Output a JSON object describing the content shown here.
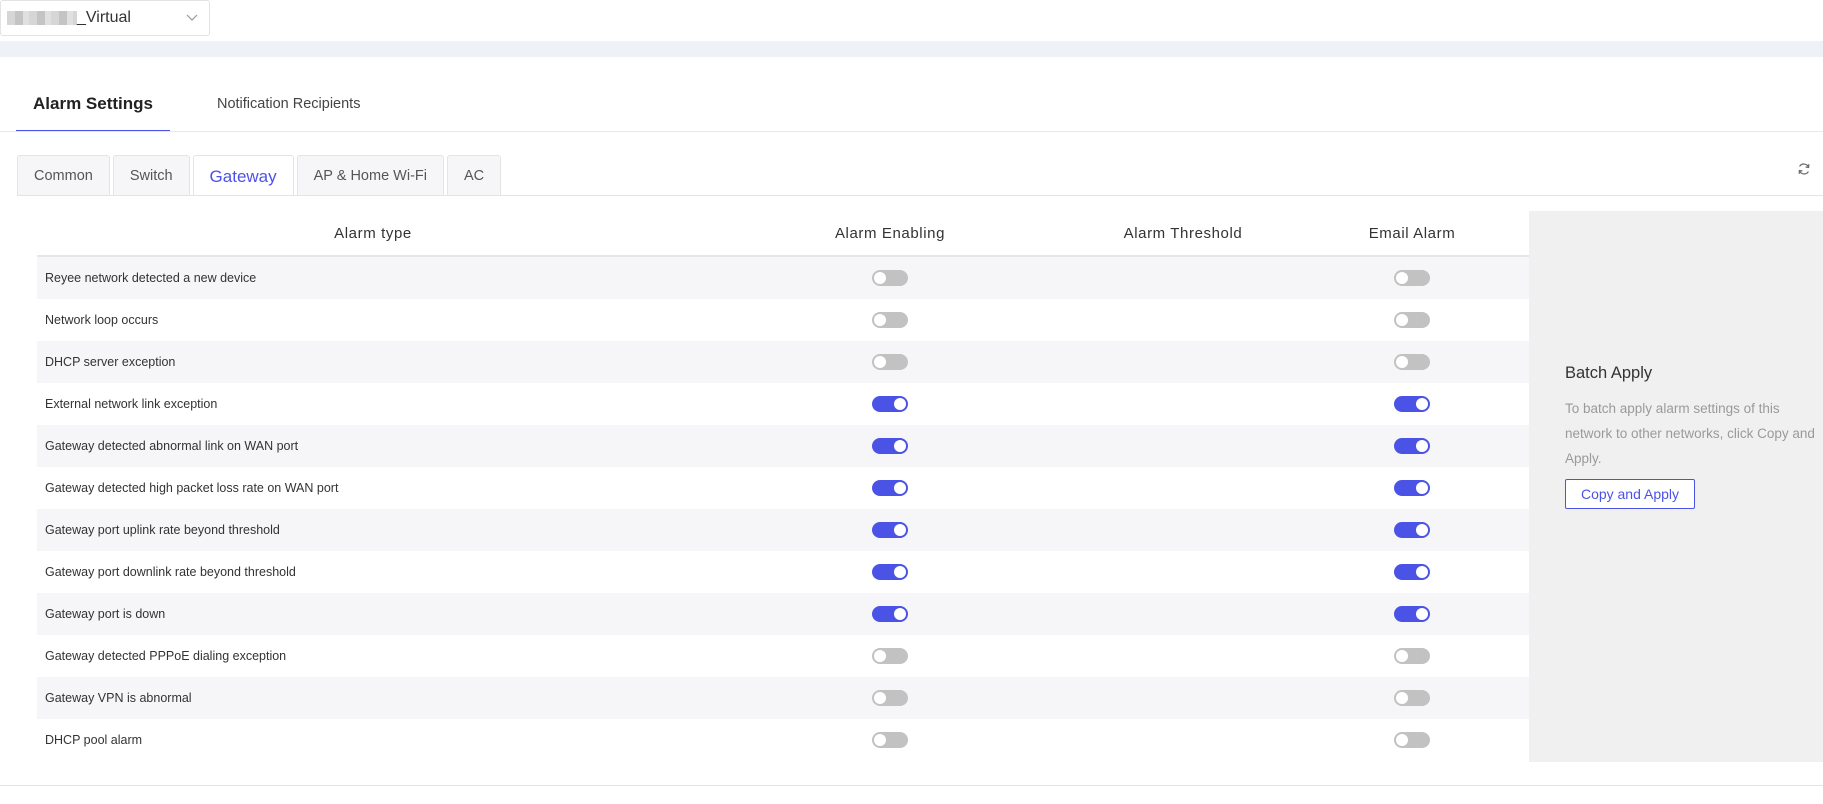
{
  "network": {
    "name": "_Virtual",
    "icon": "chevron-down-icon"
  },
  "main_tabs": [
    {
      "label": "Alarm Settings",
      "active": true
    },
    {
      "label": "Notification Recipients",
      "active": false
    }
  ],
  "sub_tabs": [
    {
      "label": "Common",
      "active": false
    },
    {
      "label": "Switch",
      "active": false
    },
    {
      "label": "Gateway",
      "active": true
    },
    {
      "label": "AP & Home Wi-Fi",
      "active": false
    },
    {
      "label": "AC",
      "active": false
    }
  ],
  "refresh_icon": "refresh-icon",
  "table": {
    "headers": [
      "Alarm type",
      "Alarm Enabling",
      "Alarm Threshold",
      "Email Alarm"
    ],
    "rows": [
      {
        "type": "Reyee network detected a new device",
        "enabled": false,
        "email": false
      },
      {
        "type": "Network loop occurs",
        "enabled": false,
        "email": false
      },
      {
        "type": "DHCP server exception",
        "enabled": false,
        "email": false
      },
      {
        "type": "External network link exception",
        "enabled": true,
        "email": true
      },
      {
        "type": "Gateway detected abnormal link on WAN port",
        "enabled": true,
        "email": true
      },
      {
        "type": "Gateway detected high packet loss rate on WAN port",
        "enabled": true,
        "email": true
      },
      {
        "type": "Gateway port uplink rate beyond threshold",
        "enabled": true,
        "email": true
      },
      {
        "type": "Gateway port downlink rate beyond threshold",
        "enabled": true,
        "email": true
      },
      {
        "type": "Gateway port is down",
        "enabled": true,
        "email": true
      },
      {
        "type": "Gateway detected PPPoE dialing exception",
        "enabled": false,
        "email": false
      },
      {
        "type": "Gateway VPN is abnormal",
        "enabled": false,
        "email": false
      },
      {
        "type": "DHCP pool alarm",
        "enabled": false,
        "email": false
      }
    ]
  },
  "batch": {
    "title": "Batch Apply",
    "description": "To batch apply alarm settings of this network to other networks, click Copy and Apply.",
    "button_label": "Copy and Apply"
  },
  "colors": {
    "accent": "#4b53e6",
    "toggle_off": "#c2c2c2",
    "panel_bg": "#f0f0f0"
  }
}
